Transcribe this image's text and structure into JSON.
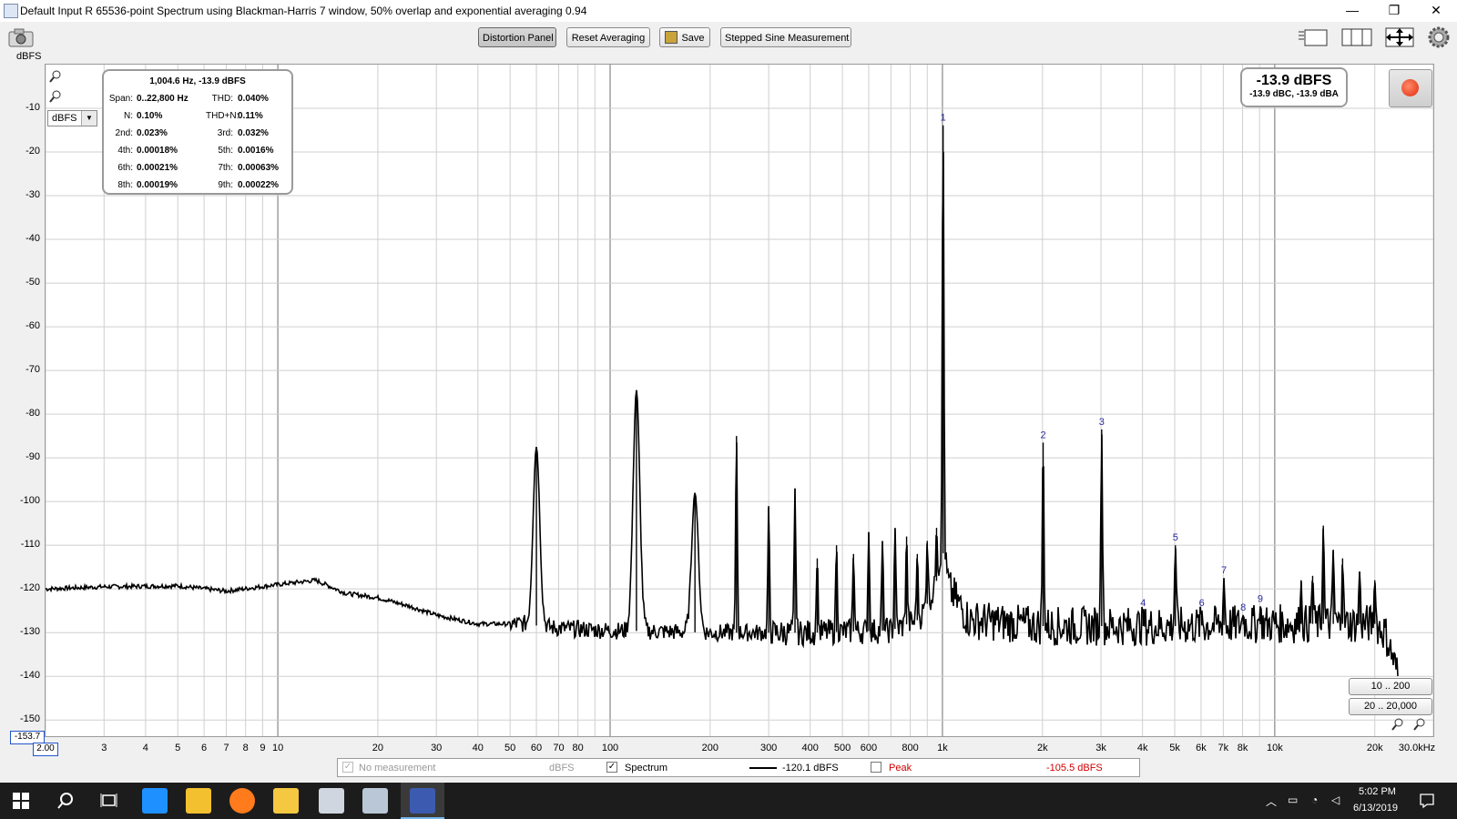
{
  "window": {
    "title": "Default Input R 65536-point Spectrum using Blackman-Harris 7 window, 50% overlap and exponential averaging 0.94",
    "minimize": "—",
    "restore": "❐",
    "close": "✕"
  },
  "toolbar": {
    "distortion_panel": "Distortion Panel",
    "reset_averaging": "Reset Averaging",
    "save": "Save",
    "stepped_sine": "Stepped Sine Measurement",
    "units_label": "dBFS"
  },
  "readout": {
    "header": "1,004.6 Hz, -13.9 dBFS",
    "rows": [
      {
        "l1": "Span:",
        "v1": "0..22,800 Hz",
        "l2": "THD:",
        "v2": "0.040%"
      },
      {
        "l1": "N:",
        "v1": "0.10%",
        "l2": "THD+N:",
        "v2": "0.11%"
      },
      {
        "l1": "2nd:",
        "v1": "0.023%",
        "l2": "3rd:",
        "v2": "0.032%"
      },
      {
        "l1": "4th:",
        "v1": "0.00018%",
        "l2": "5th:",
        "v2": "0.0016%"
      },
      {
        "l1": "6th:",
        "v1": "0.00021%",
        "l2": "7th:",
        "v2": "0.00063%"
      },
      {
        "l1": "8th:",
        "v1": "0.00019%",
        "l2": "9th:",
        "v2": "0.00022%"
      }
    ]
  },
  "level": {
    "main": "-13.9 dBFS",
    "sub": "-13.9 dBC, -13.9 dBA"
  },
  "units_select": "dBFS",
  "range_buttons": [
    "10 .. 200",
    "20 .. 20,000"
  ],
  "legend": {
    "no_measurement": "No measurement",
    "no_measurement_units": "dBFS",
    "spectrum": "Spectrum",
    "spectrum_value": "-120.1 dBFS",
    "peak": "Peak",
    "peak_value": "-105.5 dBFS"
  },
  "y_min_box": "-153.7",
  "x_min_box": "2.00",
  "taskbar": {
    "time": "5:02 PM",
    "date": "6/13/2019"
  },
  "chart_data": {
    "type": "line",
    "xscale": "log",
    "xlim": [
      2,
      30000
    ],
    "ylim": [
      -153.7,
      0
    ],
    "grid": true,
    "xlabel": "",
    "ylabel": "dBFS",
    "y_ticks": [
      -10,
      -20,
      -30,
      -40,
      -50,
      -60,
      -70,
      -80,
      -90,
      -100,
      -110,
      -120,
      -130,
      -140,
      -150
    ],
    "x_ticks": [
      {
        "v": 3,
        "t": "3"
      },
      {
        "v": 4,
        "t": "4"
      },
      {
        "v": 5,
        "t": "5"
      },
      {
        "v": 6,
        "t": "6"
      },
      {
        "v": 7,
        "t": "7"
      },
      {
        "v": 8,
        "t": "8"
      },
      {
        "v": 9,
        "t": "9"
      },
      {
        "v": 10,
        "t": "10"
      },
      {
        "v": 20,
        "t": "20"
      },
      {
        "v": 30,
        "t": "30"
      },
      {
        "v": 40,
        "t": "40"
      },
      {
        "v": 50,
        "t": "50"
      },
      {
        "v": 60,
        "t": "60"
      },
      {
        "v": 70,
        "t": "70"
      },
      {
        "v": 80,
        "t": "80"
      },
      {
        "v": 100,
        "t": "100"
      },
      {
        "v": 200,
        "t": "200"
      },
      {
        "v": 300,
        "t": "300"
      },
      {
        "v": 400,
        "t": "400"
      },
      {
        "v": 500,
        "t": "500"
      },
      {
        "v": 600,
        "t": "600"
      },
      {
        "v": 800,
        "t": "800"
      },
      {
        "v": 1000,
        "t": "1k"
      },
      {
        "v": 2000,
        "t": "2k"
      },
      {
        "v": 3000,
        "t": "3k"
      },
      {
        "v": 4000,
        "t": "4k"
      },
      {
        "v": 5000,
        "t": "5k"
      },
      {
        "v": 6000,
        "t": "6k"
      },
      {
        "v": 7000,
        "t": "7k"
      },
      {
        "v": 8000,
        "t": "8k"
      },
      {
        "v": 10000,
        "t": "10k"
      },
      {
        "v": 20000,
        "t": "20k"
      },
      {
        "v": 30000,
        "t": "30.0kHz"
      }
    ],
    "series": [
      {
        "name": "Spectrum",
        "color": "#000000",
        "floor": [
          [
            2,
            -120
          ],
          [
            3,
            -119.5
          ],
          [
            5,
            -119.3
          ],
          [
            7,
            -120.5
          ],
          [
            10,
            -119
          ],
          [
            13,
            -118
          ],
          [
            16,
            -121
          ],
          [
            20,
            -122
          ],
          [
            25,
            -124
          ],
          [
            30,
            -126
          ],
          [
            40,
            -128
          ],
          [
            55,
            -128
          ],
          [
            70,
            -129
          ],
          [
            100,
            -129.5
          ],
          [
            200,
            -130
          ],
          [
            400,
            -130
          ],
          [
            700,
            -129.5
          ],
          [
            850,
            -127
          ],
          [
            950,
            -120
          ],
          [
            1000,
            -111
          ],
          [
            1050,
            -120
          ],
          [
            1200,
            -127
          ],
          [
            2000,
            -128.5
          ],
          [
            5000,
            -128.5
          ],
          [
            10000,
            -128
          ],
          [
            20000,
            -128
          ],
          [
            21500,
            -130
          ],
          [
            22500,
            -135
          ],
          [
            23500,
            -140
          ]
        ],
        "peaks": [
          [
            60,
            -87.5
          ],
          [
            120,
            -74.5
          ],
          [
            180,
            -98
          ],
          [
            240,
            -85
          ],
          [
            300,
            -101
          ],
          [
            360,
            -97
          ],
          [
            420,
            -113
          ],
          [
            480,
            -110
          ],
          [
            540,
            -112
          ],
          [
            600,
            -107
          ],
          [
            660,
            -109
          ],
          [
            720,
            -106
          ],
          [
            780,
            -108
          ],
          [
            840,
            -112
          ],
          [
            900,
            -109
          ],
          [
            960,
            -106
          ],
          [
            1004.6,
            -13.9
          ],
          [
            2009,
            -86.5
          ],
          [
            3014,
            -83.5
          ],
          [
            4018,
            -125
          ],
          [
            5023,
            -110
          ],
          [
            6028,
            -125
          ],
          [
            7032,
            -117.5
          ],
          [
            8037,
            -126
          ],
          [
            9041,
            -124
          ],
          [
            12000,
            -118
          ],
          [
            13000,
            -117
          ],
          [
            14000,
            -105.5
          ],
          [
            15000,
            -111
          ],
          [
            16000,
            -113
          ],
          [
            18000,
            -116
          ],
          [
            20000,
            -118
          ]
        ]
      }
    ],
    "harmonic_markers": [
      {
        "label": "1",
        "f": 1004.6,
        "db": -13.9
      },
      {
        "label": "2",
        "f": 2009,
        "db": -86.5
      },
      {
        "label": "3",
        "f": 3014,
        "db": -83.5
      },
      {
        "label": "4",
        "f": 4018,
        "db": -125
      },
      {
        "label": "5",
        "f": 5023,
        "db": -110
      },
      {
        "label": "6",
        "f": 6028,
        "db": -125
      },
      {
        "label": "7",
        "f": 7032,
        "db": -117.5
      },
      {
        "label": "8",
        "f": 8037,
        "db": -126
      },
      {
        "label": "9",
        "f": 9041,
        "db": -124
      }
    ]
  }
}
